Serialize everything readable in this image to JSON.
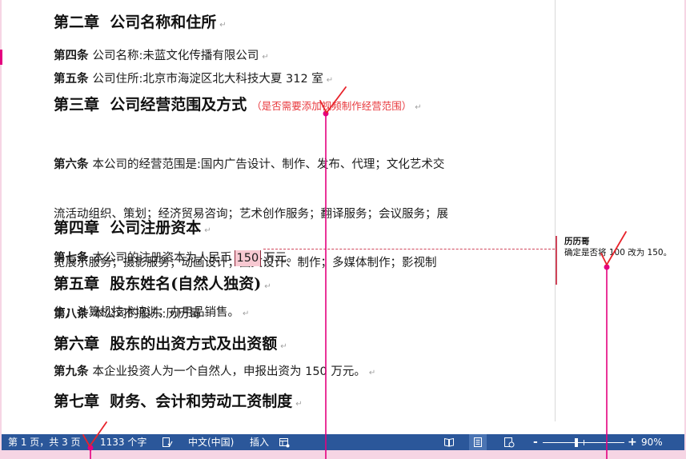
{
  "doc": {
    "paragraph_mark": "↵",
    "ch2": "第二章  公司名称和住所",
    "art4": {
      "label": "第四条",
      "text": "公司名称:未蓝文化传播有限公司"
    },
    "art5": {
      "label": "第五条",
      "text": "公司住所:北京市海淀区北大科技大夏 312 室"
    },
    "ch3": {
      "title": "第三章  公司经营范围及方式",
      "note": "（是否需要添加视频制作经营范围）"
    },
    "art6": {
      "label": "第六条",
      "lines": [
        "本公司的经营范围是:国内广告设计、制作、发布、代理；文化艺术交",
        "流活动组织、策划；经济贸易咨询；艺术创作服务；翻译服务；会议服务；展",
        "览展示服务；摄影服务；动画设计；图文设计、制作；多媒体制作；影视制",
        "作；计算机技术培训；办用品销售。"
      ]
    },
    "ch4": "第四章  公司注册资本",
    "art7": {
      "label": "第七条",
      "before": "本公司的注册资本为人民币",
      "highlight": "150",
      "after": "万元。"
    },
    "ch5": "第五章  股东姓名(自然人独资)",
    "art8": {
      "label": "第八条",
      "text": "本公司的股东:历历哥"
    },
    "ch6": "第六章  股东的出资方式及出资额",
    "art9": {
      "label": "第九条",
      "text": "本企业投资人为一个自然人，申报出资为 150 万元。"
    },
    "ch7": "第七章  财务、会计和劳动工资制度"
  },
  "comment": {
    "author": "历历哥",
    "text": "确定是否将 100 改为 150。"
  },
  "status_bar": {
    "page_info": "第 1 页，共 3 页",
    "word_count": "1133 个字",
    "proofing_icon": "proofing-icon",
    "language": "中文(中国)",
    "insert_mode": "插入",
    "macro_icon": "macro-record-icon",
    "views": [
      {
        "icon": "read-mode-icon",
        "selected": false
      },
      {
        "icon": "print-layout-icon",
        "selected": true
      },
      {
        "icon": "web-layout-icon",
        "selected": false
      }
    ],
    "zoom_out": "-",
    "zoom_in": "+",
    "zoom": "90%"
  },
  "colors": {
    "frame_background": "#f6d5e4",
    "status_bar": "#2b579a",
    "status_bar_selected": "#4a74b3",
    "comment_accent": "#d0455a",
    "comment_highlight": "#f7c9d2",
    "note_text": "#e8383d",
    "callout_line": "#e4007f",
    "check_mark": "#e8232b"
  }
}
